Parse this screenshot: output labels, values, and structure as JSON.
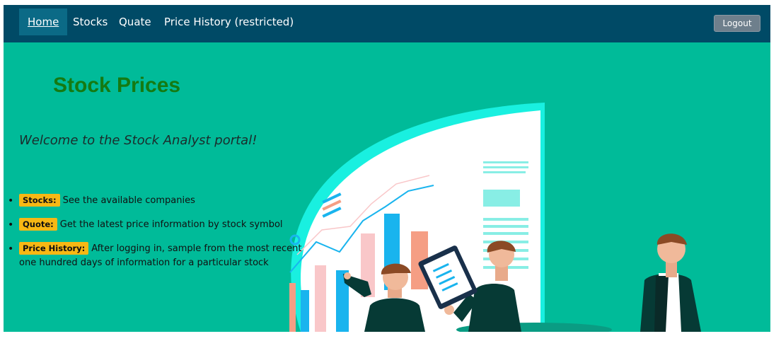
{
  "nav": {
    "items": [
      {
        "label": "Home",
        "active": true
      },
      {
        "label": "Stocks"
      },
      {
        "label": "Quate"
      },
      {
        "label": "Price History (restricted)"
      }
    ],
    "logout_label": "Logout"
  },
  "main": {
    "title": "Stock Prices",
    "welcome": "Welcome to the Stock Analyst portal!",
    "features": [
      {
        "tag": "Stocks:",
        "text": "See the available companies"
      },
      {
        "tag": "Quote:",
        "text": "Get the latest price information by stock symbol"
      },
      {
        "tag": "Price History:",
        "text": "After logging in, sample from the most recent one hundred days of information for a particular stock"
      }
    ]
  },
  "colors": {
    "navbar": "#004a66",
    "background": "#00bb99",
    "title": "#157a12",
    "tag": "#f7b814",
    "logout_button": "#6e7f8c"
  }
}
